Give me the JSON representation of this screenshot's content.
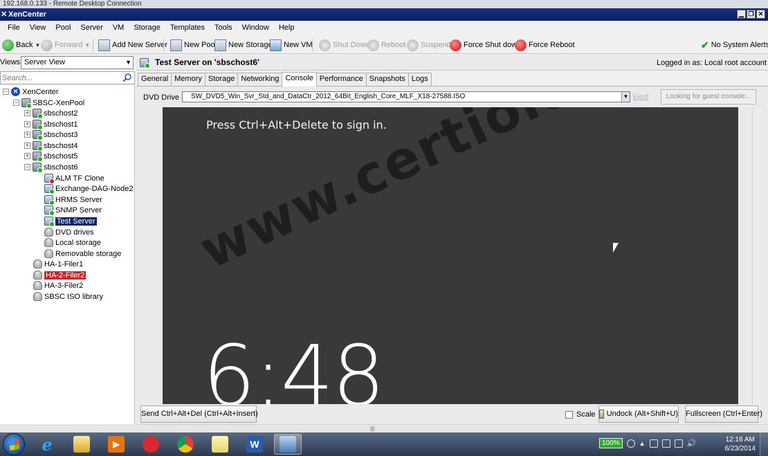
{
  "rdp": {
    "title": "192.168.0.133 - Remote Desktop Connection"
  },
  "app": {
    "title": "XenCenter"
  },
  "menu": [
    "File",
    "View",
    "Pool",
    "Server",
    "VM",
    "Storage",
    "Templates",
    "Tools",
    "Window",
    "Help"
  ],
  "toolbar": {
    "back": "Back",
    "forward": "Forward",
    "add_new_server": "Add New Server",
    "new_pool": "New Pool",
    "new_storage": "New Storage",
    "new_vm": "New VM",
    "shut_down": "Shut Down",
    "reboot": "Reboot",
    "suspend": "Suspend",
    "force_shut_down": "Force Shut down",
    "force_reboot": "Force Reboot",
    "alerts": "No System Alerts"
  },
  "views": {
    "label": "Views:",
    "selected": "Server View"
  },
  "search": {
    "placeholder": "Search..."
  },
  "tree": {
    "root": "XenCenter",
    "pool": "SBSC-XenPool",
    "hosts": [
      "sbschost2",
      "sbschost1",
      "sbschost3",
      "sbschost4",
      "sbschost5",
      "sbschost6"
    ],
    "vms": [
      "ALM TF Clone",
      "Exchange-DAG-Node2",
      "HRMS Server",
      "SNMP Server",
      "Test Server"
    ],
    "storage": [
      "DVD drives",
      "Local storage",
      "Removable storage"
    ],
    "pool_storage": [
      "HA-1-Filer1",
      "HA-2-Filer2",
      "HA-3-Filer2",
      "SBSC ISO library"
    ]
  },
  "header": {
    "title": "Test Server on 'sbschost6'",
    "logged_in": "Logged in as:  Local root account"
  },
  "tabs": [
    "General",
    "Memory",
    "Storage",
    "Networking",
    "Console",
    "Performance",
    "Snapshots",
    "Logs"
  ],
  "active_tab": "Console",
  "console": {
    "dvd_label": "DVD Drive 1:",
    "dvd_value": "SW_DVD5_Win_Svr_Std_and_DataCtr_2012_64Bit_English_Core_MLF_X18-27588.ISO",
    "eject": "Eject",
    "looking": "Looking for guest console...",
    "press_text": "Press Ctrl+Alt+Delete to sign in.",
    "clock": "6:48",
    "watermark": "www.certiology.com",
    "send_cad": "Send Ctrl+Alt+Del (Ctrl+Alt+Insert)",
    "scale": "Scale",
    "undock": "Undock (Alt+Shift+U)",
    "fullscreen": "Fullscreen (Ctrl+Enter)"
  },
  "taskbar": {
    "battery": "100%",
    "time": "12:16 AM",
    "date": "6/23/2014"
  },
  "colors": {
    "title_bar": "#0a1f66",
    "selection": "#0a246a",
    "selection_red": "#c0262a",
    "console_bg": "#393939"
  }
}
